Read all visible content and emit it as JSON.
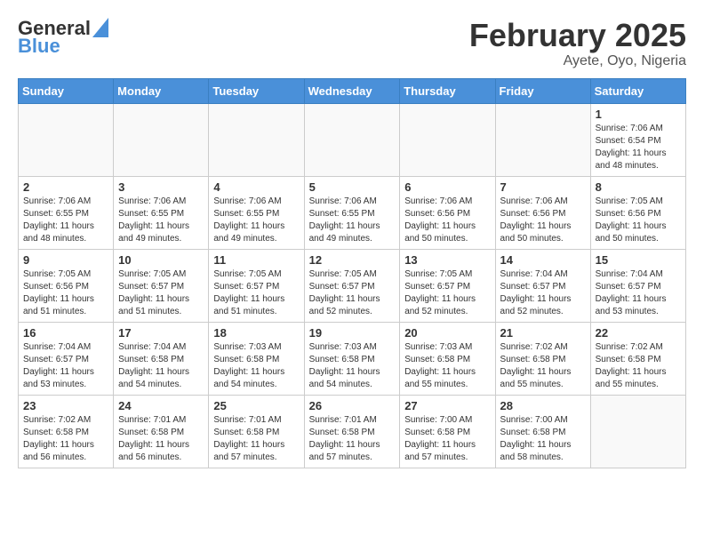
{
  "header": {
    "logo_line1": "General",
    "logo_line2": "Blue",
    "title": "February 2025",
    "subtitle": "Ayete, Oyo, Nigeria"
  },
  "days_of_week": [
    "Sunday",
    "Monday",
    "Tuesday",
    "Wednesday",
    "Thursday",
    "Friday",
    "Saturday"
  ],
  "weeks": [
    [
      {
        "day": "",
        "info": ""
      },
      {
        "day": "",
        "info": ""
      },
      {
        "day": "",
        "info": ""
      },
      {
        "day": "",
        "info": ""
      },
      {
        "day": "",
        "info": ""
      },
      {
        "day": "",
        "info": ""
      },
      {
        "day": "1",
        "info": "Sunrise: 7:06 AM\nSunset: 6:54 PM\nDaylight: 11 hours\nand 48 minutes."
      }
    ],
    [
      {
        "day": "2",
        "info": "Sunrise: 7:06 AM\nSunset: 6:55 PM\nDaylight: 11 hours\nand 48 minutes."
      },
      {
        "day": "3",
        "info": "Sunrise: 7:06 AM\nSunset: 6:55 PM\nDaylight: 11 hours\nand 49 minutes."
      },
      {
        "day": "4",
        "info": "Sunrise: 7:06 AM\nSunset: 6:55 PM\nDaylight: 11 hours\nand 49 minutes."
      },
      {
        "day": "5",
        "info": "Sunrise: 7:06 AM\nSunset: 6:55 PM\nDaylight: 11 hours\nand 49 minutes."
      },
      {
        "day": "6",
        "info": "Sunrise: 7:06 AM\nSunset: 6:56 PM\nDaylight: 11 hours\nand 50 minutes."
      },
      {
        "day": "7",
        "info": "Sunrise: 7:06 AM\nSunset: 6:56 PM\nDaylight: 11 hours\nand 50 minutes."
      },
      {
        "day": "8",
        "info": "Sunrise: 7:05 AM\nSunset: 6:56 PM\nDaylight: 11 hours\nand 50 minutes."
      }
    ],
    [
      {
        "day": "9",
        "info": "Sunrise: 7:05 AM\nSunset: 6:56 PM\nDaylight: 11 hours\nand 51 minutes."
      },
      {
        "day": "10",
        "info": "Sunrise: 7:05 AM\nSunset: 6:57 PM\nDaylight: 11 hours\nand 51 minutes."
      },
      {
        "day": "11",
        "info": "Sunrise: 7:05 AM\nSunset: 6:57 PM\nDaylight: 11 hours\nand 51 minutes."
      },
      {
        "day": "12",
        "info": "Sunrise: 7:05 AM\nSunset: 6:57 PM\nDaylight: 11 hours\nand 52 minutes."
      },
      {
        "day": "13",
        "info": "Sunrise: 7:05 AM\nSunset: 6:57 PM\nDaylight: 11 hours\nand 52 minutes."
      },
      {
        "day": "14",
        "info": "Sunrise: 7:04 AM\nSunset: 6:57 PM\nDaylight: 11 hours\nand 52 minutes."
      },
      {
        "day": "15",
        "info": "Sunrise: 7:04 AM\nSunset: 6:57 PM\nDaylight: 11 hours\nand 53 minutes."
      }
    ],
    [
      {
        "day": "16",
        "info": "Sunrise: 7:04 AM\nSunset: 6:57 PM\nDaylight: 11 hours\nand 53 minutes."
      },
      {
        "day": "17",
        "info": "Sunrise: 7:04 AM\nSunset: 6:58 PM\nDaylight: 11 hours\nand 54 minutes."
      },
      {
        "day": "18",
        "info": "Sunrise: 7:03 AM\nSunset: 6:58 PM\nDaylight: 11 hours\nand 54 minutes."
      },
      {
        "day": "19",
        "info": "Sunrise: 7:03 AM\nSunset: 6:58 PM\nDaylight: 11 hours\nand 54 minutes."
      },
      {
        "day": "20",
        "info": "Sunrise: 7:03 AM\nSunset: 6:58 PM\nDaylight: 11 hours\nand 55 minutes."
      },
      {
        "day": "21",
        "info": "Sunrise: 7:02 AM\nSunset: 6:58 PM\nDaylight: 11 hours\nand 55 minutes."
      },
      {
        "day": "22",
        "info": "Sunrise: 7:02 AM\nSunset: 6:58 PM\nDaylight: 11 hours\nand 55 minutes."
      }
    ],
    [
      {
        "day": "23",
        "info": "Sunrise: 7:02 AM\nSunset: 6:58 PM\nDaylight: 11 hours\nand 56 minutes."
      },
      {
        "day": "24",
        "info": "Sunrise: 7:01 AM\nSunset: 6:58 PM\nDaylight: 11 hours\nand 56 minutes."
      },
      {
        "day": "25",
        "info": "Sunrise: 7:01 AM\nSunset: 6:58 PM\nDaylight: 11 hours\nand 57 minutes."
      },
      {
        "day": "26",
        "info": "Sunrise: 7:01 AM\nSunset: 6:58 PM\nDaylight: 11 hours\nand 57 minutes."
      },
      {
        "day": "27",
        "info": "Sunrise: 7:00 AM\nSunset: 6:58 PM\nDaylight: 11 hours\nand 57 minutes."
      },
      {
        "day": "28",
        "info": "Sunrise: 7:00 AM\nSunset: 6:58 PM\nDaylight: 11 hours\nand 58 minutes."
      },
      {
        "day": "",
        "info": ""
      }
    ]
  ]
}
